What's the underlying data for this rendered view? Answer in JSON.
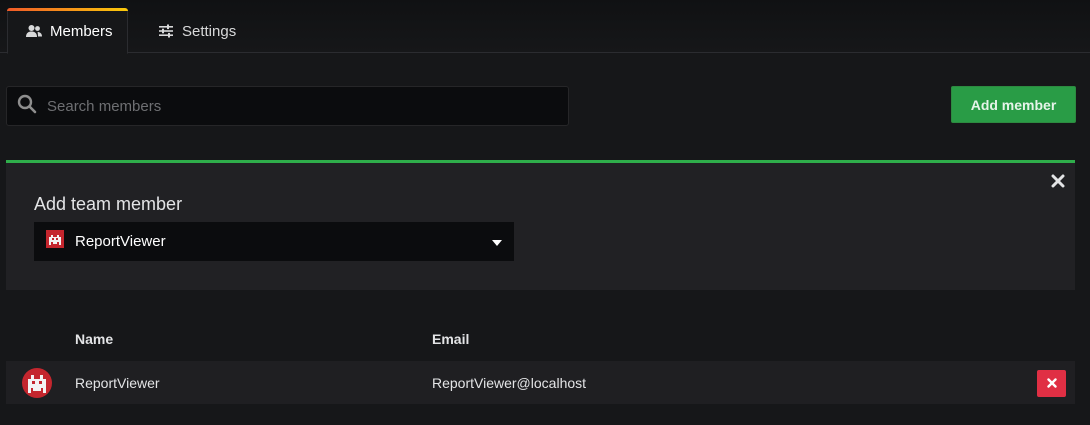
{
  "tabs": [
    {
      "label": "Members",
      "icon": "users-icon",
      "active": true
    },
    {
      "label": "Settings",
      "icon": "sliders-icon",
      "active": false
    }
  ],
  "search": {
    "placeholder": "Search members",
    "value": ""
  },
  "actions": {
    "add_member_label": "Add member"
  },
  "add_panel": {
    "title": "Add team member",
    "selected_user": "ReportViewer"
  },
  "table": {
    "columns": [
      "Name",
      "Email"
    ],
    "rows": [
      {
        "name": "ReportViewer",
        "email": "ReportViewer@localhost"
      }
    ]
  },
  "colors": {
    "background": "#161719",
    "primary_green": "#299c46",
    "panel_accent": "#2fae4b",
    "danger": "#e02f44",
    "avatar_red": "#c4262e"
  }
}
